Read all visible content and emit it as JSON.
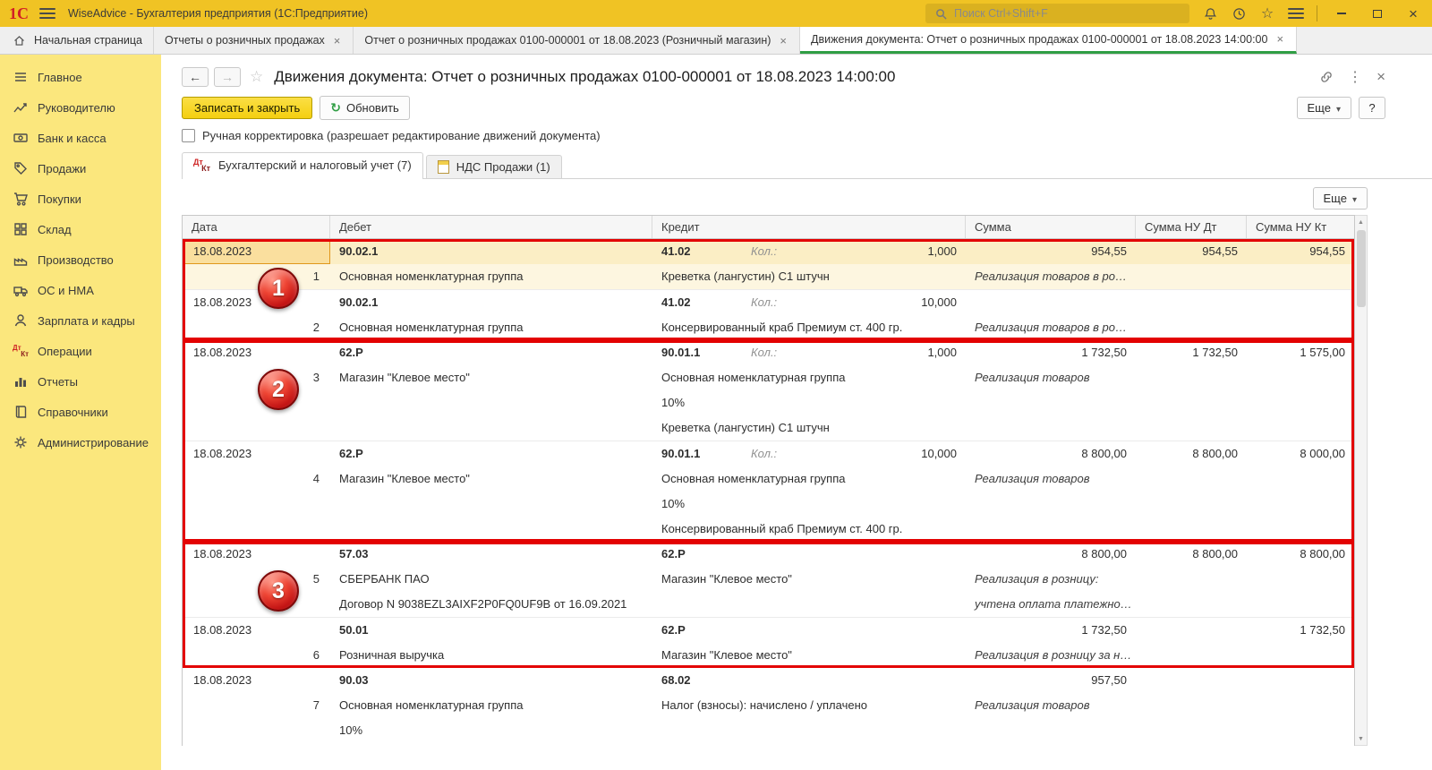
{
  "titlebar": {
    "logo": "1С",
    "title": "WiseAdvice - Бухгалтерия предприятия  (1С:Предприятие)",
    "search_placeholder": "Поиск Ctrl+Shift+F"
  },
  "window_tabs": [
    {
      "label": "Начальная страница"
    },
    {
      "label": "Отчеты о розничных продажах"
    },
    {
      "label": "Отчет о розничных продажах 0100-000001 от 18.08.2023 (Розничный магазин)"
    },
    {
      "label": "Движения документа: Отчет о розничных продажах 0100-000001 от 18.08.2023 14:00:00",
      "active": true
    }
  ],
  "sidebar": {
    "items": [
      {
        "label": "Главное"
      },
      {
        "label": "Руководителю"
      },
      {
        "label": "Банк и касса"
      },
      {
        "label": "Продажи"
      },
      {
        "label": "Покупки"
      },
      {
        "label": "Склад"
      },
      {
        "label": "Производство"
      },
      {
        "label": "ОС и НМА"
      },
      {
        "label": "Зарплата и кадры"
      },
      {
        "label": "Операции"
      },
      {
        "label": "Отчеты"
      },
      {
        "label": "Справочники"
      },
      {
        "label": "Администрирование"
      }
    ]
  },
  "page": {
    "title": "Движения документа: Отчет о розничных продажах 0100-000001 от 18.08.2023 14:00:00",
    "buttons": {
      "save_close": "Записать и закрыть",
      "refresh": "Обновить",
      "more": "Еще",
      "help": "?"
    },
    "checkbox_label": "Ручная корректировка (разрешает редактирование движений документа)",
    "doc_tabs": [
      {
        "label": "Бухгалтерский и налоговый учет (7)",
        "active": true
      },
      {
        "label": "НДС Продажи (1)"
      }
    ],
    "table_more": "Еще"
  },
  "table": {
    "columns": [
      "Дата",
      "Дебет",
      "Кредит",
      "Сумма",
      "Сумма НУ Дт",
      "Сумма НУ Кт"
    ],
    "entries": [
      {
        "date": "18.08.2023",
        "dt_account": "90.02.1",
        "kt_account": "41.02",
        "qty_label": "Кол.:",
        "qty": "1,000",
        "sum": "954,55",
        "nu_dt": "954,55",
        "nu_kt": "954,55",
        "selected": true,
        "rows": [
          {
            "num": "1",
            "dt": "Основная номенклатурная группа",
            "kt": "Креветка (лангустин) С1 штучн",
            "comment": "Реализация товаров в ро…"
          }
        ]
      },
      {
        "date": "18.08.2023",
        "dt_account": "90.02.1",
        "kt_account": "41.02",
        "qty_label": "Кол.:",
        "qty": "10,000",
        "sum": "",
        "nu_dt": "",
        "nu_kt": "",
        "rows": [
          {
            "num": "2",
            "dt": "Основная номенклатурная группа",
            "kt": "Консервированный краб Премиум ст. 400 гр.",
            "comment": "Реализация товаров в ро…"
          }
        ]
      },
      {
        "date": "18.08.2023",
        "dt_account": "62.Р",
        "kt_account": "90.01.1",
        "qty_label": "Кол.:",
        "qty": "1,000",
        "sum": "1 732,50",
        "nu_dt": "1 732,50",
        "nu_kt": "1 575,00",
        "rows": [
          {
            "num": "3",
            "dt": "Магазин \"Клевое место\"",
            "kt": "Основная номенклатурная группа",
            "comment": "Реализация товаров"
          },
          {
            "num": "",
            "dt": "",
            "kt": "10%",
            "comment": ""
          },
          {
            "num": "",
            "dt": "",
            "kt": "Креветка (лангустин) С1 штучн",
            "comment": ""
          }
        ]
      },
      {
        "date": "18.08.2023",
        "dt_account": "62.Р",
        "kt_account": "90.01.1",
        "qty_label": "Кол.:",
        "qty": "10,000",
        "sum": "8 800,00",
        "nu_dt": "8 800,00",
        "nu_kt": "8 000,00",
        "rows": [
          {
            "num": "4",
            "dt": "Магазин \"Клевое место\"",
            "kt": "Основная номенклатурная группа",
            "comment": "Реализация товаров"
          },
          {
            "num": "",
            "dt": "",
            "kt": "10%",
            "comment": ""
          },
          {
            "num": "",
            "dt": "",
            "kt": "Консервированный краб Премиум ст. 400 гр.",
            "comment": ""
          }
        ]
      },
      {
        "date": "18.08.2023",
        "dt_account": "57.03",
        "kt_account": "62.Р",
        "qty_label": "",
        "qty": "",
        "sum": "8 800,00",
        "nu_dt": "8 800,00",
        "nu_kt": "8 800,00",
        "rows": [
          {
            "num": "5",
            "dt": "СБЕРБАНК ПАО",
            "kt": "Магазин \"Клевое место\"",
            "comment": "Реализация в розницу:"
          },
          {
            "num": "",
            "dt": "Договор N 9038EZL3AIXF2P0FQ0UF9B от 16.09.2021",
            "kt": "",
            "comment": "учтена оплата платежно…"
          }
        ]
      },
      {
        "date": "18.08.2023",
        "dt_account": "50.01",
        "kt_account": "62.Р",
        "qty_label": "",
        "qty": "",
        "sum": "1 732,50",
        "nu_dt": "",
        "nu_kt": "1 732,50",
        "rows": [
          {
            "num": "6",
            "dt": "Розничная выручка",
            "kt": "Магазин \"Клевое место\"",
            "comment": "Реализация в розницу за н…"
          }
        ]
      },
      {
        "date": "18.08.2023",
        "dt_account": "90.03",
        "kt_account": "68.02",
        "qty_label": "",
        "qty": "",
        "sum": "957,50",
        "nu_dt": "",
        "nu_kt": "",
        "rows": [
          {
            "num": "7",
            "dt": "Основная номенклатурная группа",
            "kt": "Налог (взносы): начислено / уплачено",
            "comment": "Реализация товаров"
          },
          {
            "num": "",
            "dt": "10%",
            "kt": "",
            "comment": ""
          }
        ]
      }
    ],
    "layout": [
      {
        "type": "group",
        "badge": "1",
        "entries": [
          0,
          1
        ]
      },
      {
        "type": "group",
        "badge": "2",
        "entries": [
          2,
          3
        ]
      },
      {
        "type": "group",
        "badge": "3",
        "entries": [
          4,
          5
        ]
      },
      {
        "type": "plain",
        "badge": "",
        "entries": [
          6
        ]
      }
    ]
  },
  "colors": {
    "titlebar_yellow": "#f0c324",
    "sidebar_yellow": "#fbe77d",
    "annotation_red": "#e30202",
    "active_tab_green": "#2f9e44",
    "primary_button_yellow": "#f4cf10",
    "selected_row_cream": "#fbeec5"
  }
}
